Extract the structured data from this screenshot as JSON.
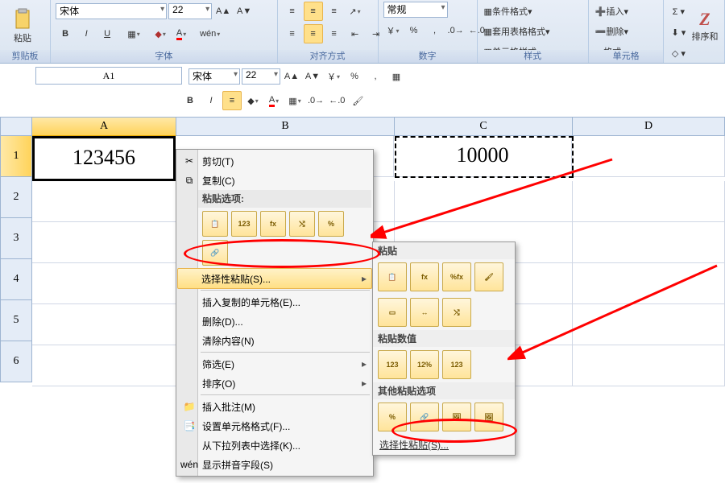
{
  "ribbon": {
    "clipboard": {
      "paste": "粘贴",
      "label": "剪贴板"
    },
    "font": {
      "name": "宋体",
      "size": "22",
      "label": "字体"
    },
    "align": {
      "label": "对齐方式"
    },
    "number": {
      "combo": "常规",
      "label": "数字",
      "pct": "%",
      "comma": ","
    },
    "styles": {
      "cond": "条件格式",
      "table": "套用表格格式",
      "cell": "单元格样式",
      "label": "样式"
    },
    "cells": {
      "insert": "插入",
      "delete": "删除",
      "format": "格式",
      "label": "单元格"
    },
    "edit": {
      "sort": "排序和"
    }
  },
  "namebox": "A1",
  "mini": {
    "font": "宋体",
    "size": "22"
  },
  "cols": [
    "A",
    "B",
    "C",
    "D"
  ],
  "rows": [
    "1",
    "2",
    "3",
    "4",
    "5",
    "6"
  ],
  "cellA1": "123456",
  "cellC1": "10000",
  "ctx": {
    "cut": "剪切(T)",
    "copy": "复制(C)",
    "pasteopt": "粘贴选项:",
    "pspecial": "选择性粘贴(S)...",
    "insert": "插入复制的单元格(E)...",
    "delete": "删除(D)...",
    "clear": "清除内容(N)",
    "filter": "筛选(E)",
    "sort": "排序(O)",
    "comment": "插入批注(M)",
    "format": "设置单元格格式(F)...",
    "dropdown": "从下拉列表中选择(K)...",
    "pinyin": "显示拼音字段(S)"
  },
  "sub": {
    "paste": "粘贴",
    "pval": "粘贴数值",
    "pother": "其他粘贴选项",
    "pspecial": "选择性粘贴(S)..."
  },
  "picolabels": {
    "v123": "123",
    "fx": "fx",
    "pct": "%"
  }
}
